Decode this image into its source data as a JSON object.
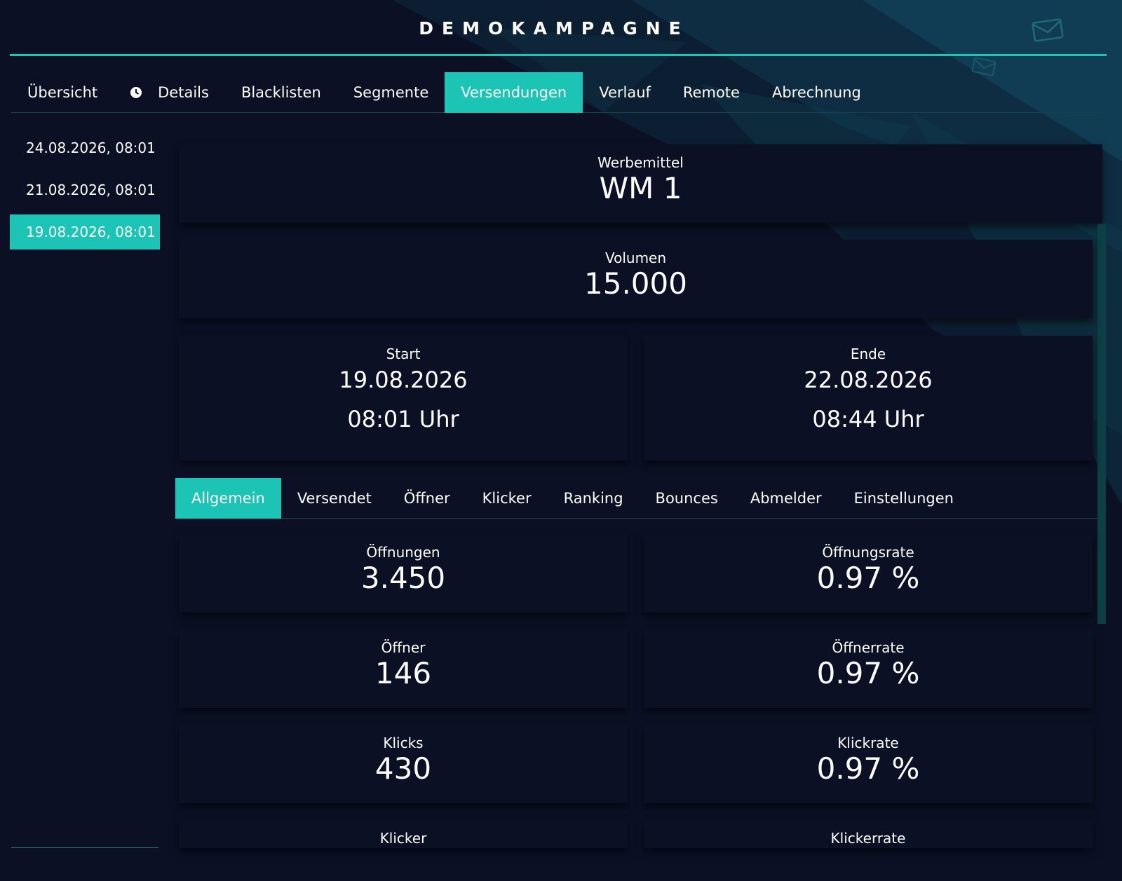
{
  "header": {
    "title": "DEMOKAMPAGNE"
  },
  "colors": {
    "accent": "#1bc4b5",
    "background": "#0b1024",
    "card": "#0b1024"
  },
  "main_tabs": [
    {
      "label": "Übersicht"
    },
    {
      "label": "Details",
      "icon": "clock-icon"
    },
    {
      "label": "Blacklisten"
    },
    {
      "label": "Segmente"
    },
    {
      "label": "Versendungen",
      "active": true
    },
    {
      "label": "Verlauf"
    },
    {
      "label": "Remote"
    },
    {
      "label": "Abrechnung"
    }
  ],
  "dates": [
    {
      "label": "24.08.2026, 08:01"
    },
    {
      "label": "21.08.2026, 08:01"
    },
    {
      "label": "19.08.2026, 08:01",
      "active": true
    }
  ],
  "werbemittel": {
    "label": "Werbemittel",
    "value": "WM 1"
  },
  "volumen": {
    "label": "Volumen",
    "value": "15.000"
  },
  "start": {
    "label": "Start",
    "date": "19.08.2026",
    "time": "08:01 Uhr"
  },
  "ende": {
    "label": "Ende",
    "date": "22.08.2026",
    "time": "08:44 Uhr"
  },
  "sub_tabs": [
    {
      "label": "Allgemein",
      "active": true
    },
    {
      "label": "Versendet"
    },
    {
      "label": "Öffner"
    },
    {
      "label": "Klicker"
    },
    {
      "label": "Ranking"
    },
    {
      "label": "Bounces"
    },
    {
      "label": "Abmelder"
    },
    {
      "label": "Einstellungen"
    }
  ],
  "stats": {
    "oeffnungen": {
      "label": "Öffnungen",
      "value": "3.450"
    },
    "oeffnungsrate": {
      "label": "Öffnungsrate",
      "value": "0.97 %"
    },
    "oeffner": {
      "label": "Öffner",
      "value": "146"
    },
    "oeffnerrate": {
      "label": "Öffnerrate",
      "value": "0.97 %"
    },
    "klicks": {
      "label": "Klicks",
      "value": "430"
    },
    "klickrate": {
      "label": "Klickrate",
      "value": "0.97 %"
    },
    "klicker": {
      "label": "Klicker"
    },
    "klickerrate": {
      "label": "Klickerrate"
    }
  }
}
